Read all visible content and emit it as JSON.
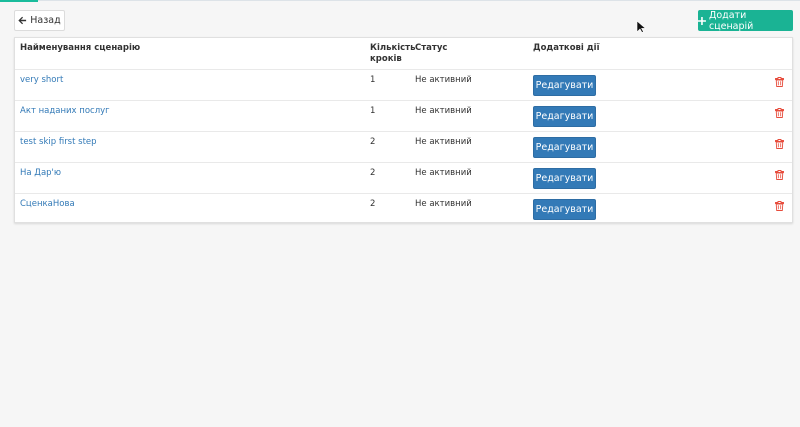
{
  "toolbar": {
    "back_label": "Назад",
    "add_label": "Додати сценарій"
  },
  "table": {
    "headers": {
      "name": "Найменування сценарію",
      "steps_line1": "Кількість",
      "steps_line2": "кроків",
      "status": "Статус",
      "extra": "Додаткові дії"
    },
    "edit_label": "Редагувати",
    "rows": [
      {
        "name": "very short",
        "steps": "1",
        "status": "Не активний"
      },
      {
        "name": "Акт наданих послуг",
        "steps": "1",
        "status": "Не активний"
      },
      {
        "name": "test skip first step",
        "steps": "2",
        "status": "Не активний"
      },
      {
        "name": "На Дар'ю",
        "steps": "2",
        "status": "Не активний"
      },
      {
        "name": "СценкаНова",
        "steps": "2",
        "status": "Не активний"
      }
    ]
  },
  "colors": {
    "accent": "#1ab394",
    "primary": "#337ab7",
    "danger": "#e74c3c"
  },
  "icons": [
    "arrow-left-icon",
    "plus-icon",
    "trash-icon",
    "cursor-icon"
  ]
}
